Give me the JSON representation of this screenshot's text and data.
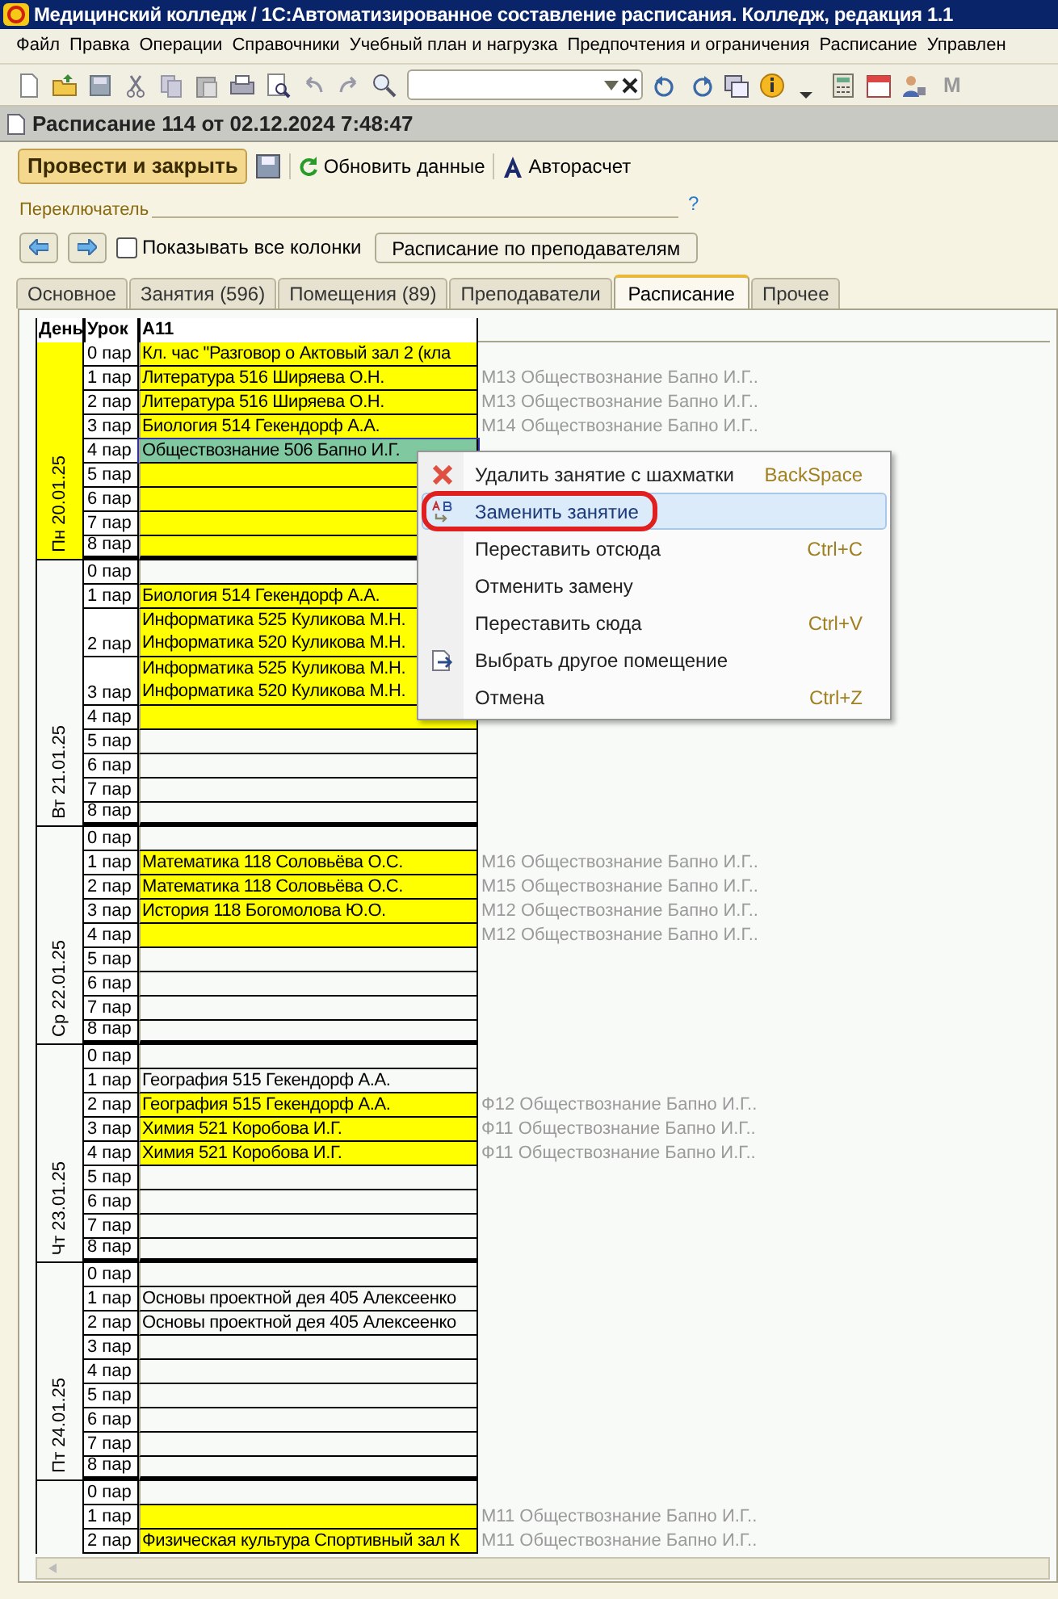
{
  "window": {
    "title": "Медицинский колледж / 1С:Автоматизированное составление расписания. Колледж, редакция 1.1"
  },
  "menu_bar": [
    "Файл",
    "Правка",
    "Операции",
    "Справочники",
    "Учебный план и нагрузка",
    "Предпочтения и ограничения",
    "Расписание",
    "Управлен"
  ],
  "toolbar": {
    "extra_label": "М"
  },
  "document": {
    "title": "Расписание 114 от 02.12.2024 7:48:47"
  },
  "commands": [
    {
      "kind": "primary",
      "label": "Провести и закрыть"
    },
    {
      "kind": "refresh",
      "label": "Обновить данные"
    },
    {
      "kind": "autocalc",
      "label": "Авторасчет"
    }
  ],
  "switcher": {
    "label": "Переключатель",
    "help": "?",
    "show_all_columns": {
      "label": "Показывать все колонки",
      "checked": false
    },
    "button": "Расписание по преподавателям"
  },
  "tabs": [
    {
      "label": "Основное",
      "selected": false
    },
    {
      "label": "Занятия (596)",
      "selected": false
    },
    {
      "label": "Помещения (89)",
      "selected": false
    },
    {
      "label": "Преподаватели",
      "selected": false
    },
    {
      "label": "Расписание",
      "selected": true
    },
    {
      "label": "Прочее",
      "selected": false
    }
  ],
  "table": {
    "columns": [
      "День",
      "Урок",
      "А11"
    ],
    "days": [
      {
        "label": "Пн 20.01.25",
        "highlighted": true,
        "lessons": [
          {
            "period": "0 пар",
            "kind": "scheduled",
            "lines": [
              "Кл. час \"Разговор о  Актовый зал 2 (кла"
            ]
          },
          {
            "period": "1 пар",
            "kind": "scheduled",
            "lines": [
              "Литература 516 Ширяева О.Н."
            ],
            "note": "М13 Обществознание Бапно И.Г.."
          },
          {
            "period": "2 пар",
            "kind": "scheduled",
            "lines": [
              "Литература 516 Ширяева О.Н."
            ],
            "note": "М13 Обществознание Бапно И.Г.."
          },
          {
            "period": "3 пар",
            "kind": "scheduled",
            "lines": [
              "Биология 514 Гекендорф А.А."
            ],
            "note": "М14 Обществознание Бапно И.Г.."
          },
          {
            "period": "4 пар",
            "kind": "selected",
            "lines": [
              "Обществознание 506 Бапно И.Г."
            ]
          },
          {
            "period": "5 пар",
            "kind": "scheduled"
          },
          {
            "period": "6 пар",
            "kind": "scheduled"
          },
          {
            "period": "7 пар",
            "kind": "scheduled"
          },
          {
            "period": "8 пар",
            "kind": "scheduled"
          }
        ]
      },
      {
        "label": "Вт 21.01.25",
        "highlighted": false,
        "lessons": [
          {
            "period": "0 пар",
            "kind": "free"
          },
          {
            "period": "1 пар",
            "kind": "scheduled",
            "lines": [
              "Биология 514 Гекендорф А.А."
            ]
          },
          {
            "period": "2 пар",
            "kind": "scheduled",
            "lines": [
              "Информатика 525 Куликова М.Н.",
              "Информатика 520 Куликова М.Н."
            ]
          },
          {
            "period": "3 пар",
            "kind": "scheduled",
            "lines": [
              "Информатика 525 Куликова М.Н.",
              "Информатика 520 Куликова М.Н."
            ]
          },
          {
            "period": "4 пар",
            "kind": "scheduled"
          },
          {
            "period": "5 пар",
            "kind": "free"
          },
          {
            "period": "6 пар",
            "kind": "free"
          },
          {
            "period": "7 пар",
            "kind": "free"
          },
          {
            "period": "8 пар",
            "kind": "free"
          }
        ]
      },
      {
        "label": "Ср 22.01.25",
        "highlighted": false,
        "lessons": [
          {
            "period": "0 пар",
            "kind": "free"
          },
          {
            "period": "1 пар",
            "kind": "scheduled",
            "lines": [
              "Математика 118 Соловьёва О.С."
            ],
            "note": "М16 Обществознание Бапно И.Г.."
          },
          {
            "period": "2 пар",
            "kind": "scheduled",
            "lines": [
              "Математика 118 Соловьёва О.С."
            ],
            "note": "М15 Обществознание Бапно И.Г.."
          },
          {
            "period": "3 пар",
            "kind": "scheduled",
            "lines": [
              "История 118 Богомолова Ю.О."
            ],
            "note": "М12 Обществознание Бапно И.Г.."
          },
          {
            "period": "4 пар",
            "kind": "scheduled",
            "note": "М12 Обществознание Бапно И.Г.."
          },
          {
            "period": "5 пар",
            "kind": "free"
          },
          {
            "period": "6 пар",
            "kind": "free"
          },
          {
            "period": "7 пар",
            "kind": "free"
          },
          {
            "period": "8 пар",
            "kind": "free"
          }
        ]
      },
      {
        "label": "Чт 23.01.25",
        "highlighted": false,
        "lessons": [
          {
            "period": "0 пар",
            "kind": "free"
          },
          {
            "period": "1 пар",
            "kind": "free",
            "lines": [
              "География 515 Гекендорф А.А."
            ]
          },
          {
            "period": "2 пар",
            "kind": "scheduled",
            "lines": [
              "География 515 Гекендорф А.А."
            ],
            "note": "Ф12 Обществознание Бапно И.Г.."
          },
          {
            "period": "3 пар",
            "kind": "scheduled",
            "lines": [
              "Химия 521  Коробова И.Г."
            ],
            "note": "Ф11 Обществознание Бапно И.Г.."
          },
          {
            "period": "4 пар",
            "kind": "scheduled",
            "lines": [
              "Химия 521  Коробова И.Г."
            ],
            "note": "Ф11 Обществознание Бапно И.Г.."
          },
          {
            "period": "5 пар",
            "kind": "free"
          },
          {
            "period": "6 пар",
            "kind": "free"
          },
          {
            "period": "7 пар",
            "kind": "free"
          },
          {
            "period": "8 пар",
            "kind": "free"
          }
        ]
      },
      {
        "label": "Пт 24.01.25",
        "highlighted": false,
        "lessons": [
          {
            "period": "0 пар",
            "kind": "free"
          },
          {
            "period": "1 пар",
            "kind": "free",
            "lines": [
              "Основы проектной дея 405 Алексеенко"
            ]
          },
          {
            "period": "2 пар",
            "kind": "free",
            "lines": [
              "Основы проектной дея 405 Алексеенко"
            ]
          },
          {
            "period": "3 пар",
            "kind": "free"
          },
          {
            "period": "4 пар",
            "kind": "free"
          },
          {
            "period": "5 пар",
            "kind": "free"
          },
          {
            "period": "6 пар",
            "kind": "free"
          },
          {
            "period": "7 пар",
            "kind": "free"
          },
          {
            "period": "8 пар",
            "kind": "free"
          }
        ]
      },
      {
        "highlighted": false,
        "lessons": [
          {
            "period": "0 пар",
            "kind": "free"
          },
          {
            "period": "1 пар",
            "kind": "scheduled",
            "note": "М11 Обществознание Бапно И.Г.."
          },
          {
            "period": "2 пар",
            "kind": "scheduled",
            "lines": [
              "Физическая культура Спортивный зал К"
            ],
            "note": "М11 Обществознание Бапно И.Г.."
          }
        ]
      }
    ]
  },
  "context_menu": {
    "items": [
      {
        "kind": "delete",
        "label": "Удалить занятие с шахматки",
        "shortcut": "BackSpace",
        "selected": false
      },
      {
        "kind": "replace",
        "label": "Заменить занятие",
        "selected": true
      },
      {
        "kind": "plain",
        "label": "Переставить отсюда",
        "shortcut": "Ctrl+C",
        "selected": false
      },
      {
        "kind": "plain",
        "label": "Отменить замену",
        "selected": false
      },
      {
        "kind": "plain",
        "label": "Переставить сюда",
        "shortcut": "Ctrl+V",
        "selected": false
      },
      {
        "kind": "room",
        "label": "Выбрать другое помещение",
        "selected": false
      },
      {
        "kind": "plain",
        "label": "Отмена",
        "shortcut": "Ctrl+Z",
        "selected": false
      }
    ]
  }
}
